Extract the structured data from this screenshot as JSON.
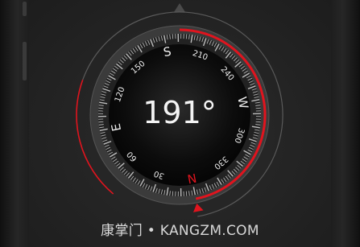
{
  "compass": {
    "heading": "191°",
    "heading_degrees": 191,
    "cardinals": [
      {
        "label": "S",
        "bearing": 180
      },
      {
        "label": "W",
        "bearing": 270
      },
      {
        "label": "N",
        "bearing": 0
      },
      {
        "label": "E",
        "bearing": 90
      }
    ],
    "degree_labels": [
      {
        "label": "210",
        "bearing": 210
      },
      {
        "label": "240",
        "bearing": 240
      },
      {
        "label": "300",
        "bearing": 300
      },
      {
        "label": "330",
        "bearing": 330
      },
      {
        "label": "30",
        "bearing": 30
      },
      {
        "label": "60",
        "bearing": 60
      },
      {
        "label": "120",
        "bearing": 120
      },
      {
        "label": "150",
        "bearing": 150
      }
    ],
    "colors": {
      "accent": "#e0141e",
      "north": "#e0141e",
      "text": "#f0f0f0",
      "ticks": "#bdbdbd"
    }
  },
  "watermark": "康掌门 • KANGZM.COM"
}
